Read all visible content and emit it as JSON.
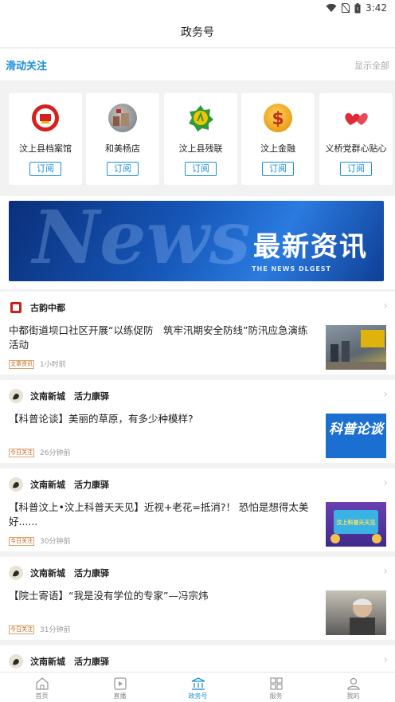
{
  "status_bar": {
    "time": "3:42"
  },
  "header": {
    "title": "政务号"
  },
  "follow_bar": {
    "title": "滑动关注",
    "show_all": "显示全部"
  },
  "accounts": [
    {
      "name": "汶上县档案馆",
      "button": "订阅",
      "icon": "archive-emblem-icon"
    },
    {
      "name": "和美杨店",
      "button": "订阅",
      "icon": "town-photo-icon"
    },
    {
      "name": "汶上县残联",
      "button": "订阅",
      "icon": "disability-federation-icon"
    },
    {
      "name": "汶上金融",
      "button": "订阅",
      "icon": "finance-coin-icon"
    },
    {
      "name": "义桥党群心贴心",
      "button": "订阅",
      "icon": "hearts-icon"
    }
  ],
  "banner": {
    "title": "最新资讯",
    "subtitle": "THE NEWS DLGEST",
    "bg_text": "News"
  },
  "articles": [
    {
      "source": "古韵中都",
      "headline": "中都街道坝口社区开展“以练促防　筑牢汛期安全防线”防汛应急演练活动",
      "tag": "文章资讯",
      "time": "1小时前"
    },
    {
      "source": "汶南新城　活力康驿",
      "headline": "【科普论谈】美丽的草原，有多少种模样?",
      "tag": "今日关注",
      "time": "26分钟前",
      "thumb_text": "科普论谈"
    },
    {
      "source": "汶南新城　活力康驿",
      "headline": "【科普汶上•汶上科普天天见】近视+老花=抵消?！ 恐怕是想得太美好......",
      "tag": "今日关注",
      "time": "30分钟前",
      "thumb_text": "汶上科普天天见"
    },
    {
      "source": "汶南新城　活力康驿",
      "headline": "【院士寄语】“我是没有学位的专家”—冯宗炜",
      "tag": "今日关注",
      "time": "31分钟前"
    },
    {
      "source": "汶南新城　活力康驿"
    }
  ],
  "tabbar": [
    {
      "label": "首页",
      "icon": "home-icon"
    },
    {
      "label": "直播",
      "icon": "live-icon"
    },
    {
      "label": "政务号",
      "icon": "government-icon",
      "active": true
    },
    {
      "label": "服务",
      "icon": "grid-icon"
    },
    {
      "label": "我的",
      "icon": "user-icon"
    }
  ],
  "colors": {
    "accent": "#1e8fd6",
    "tag": "#b9651d"
  }
}
